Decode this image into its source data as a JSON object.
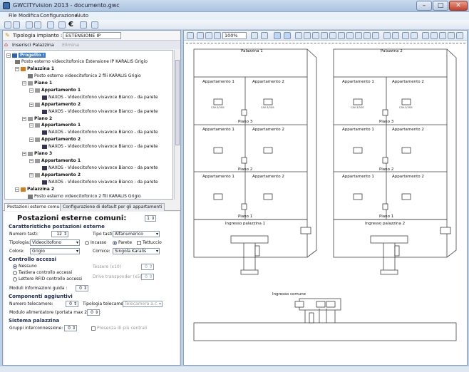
{
  "window": {
    "title": "GWCITYvision 2013 - documento.gwc",
    "min": "–",
    "max": "□",
    "close": "✕"
  },
  "menu": [
    "File",
    "Modifica",
    "Configurazione",
    "Aiuto"
  ],
  "typology": {
    "label": "Tipologia impianto :",
    "value": "ESTENSIONE IP"
  },
  "left_tabs": {
    "insert": "Inserisci Palazzina",
    "delete": "Elimina"
  },
  "tree": {
    "root": "Progetto :",
    "entrance": "Posto esterno videocitofonico Estensione IP KARALIS Grigio",
    "palazzina1": "Palazzina 1",
    "p1_post": "Posto esterno videocitofonico 2 fili KARALIS Grigio",
    "piano1": "Piano 1",
    "piano2": "Piano 2",
    "piano3": "Piano 3",
    "app1": "Appartamento 1",
    "app2": "Appartamento 2",
    "device": "NAXOS - Videocitofono vivavoce Bianco - da parete",
    "palazzina2": "Palazzina 2",
    "p2_post": "Posto esterno videocitofonico 2 fili KARALIS Grigio"
  },
  "panel_tabs": [
    "Postazioni esterne comuni",
    "Configurazione di default per gli appartamenti"
  ],
  "form": {
    "title": "Postazioni esterne comuni:",
    "count": "1",
    "s1": "Caratteristiche postazioni esterne",
    "num_tasti_label": "Numero tasti:",
    "num_tasti": "12",
    "tipo_tasti_label": "Tipo tasti:",
    "tipo_tasti": "Alfanumerico",
    "tipologia_label": "Tipologia:",
    "tipologia": "Videocitofono",
    "incasso": "Incasso",
    "parete": "Parete",
    "tettuccio": "Tettuccio",
    "colore_label": "Colore:",
    "colore": "Grigio",
    "cornice_label": "Cornice:",
    "cornice": "Singola Karalis",
    "s2": "Controllo accessi",
    "nessuno": "Nessuno",
    "tastiera": "Tastiera controllo accessi",
    "lettore": "Lettore RFID controllo accessi",
    "tessere_label": "Tessere (x10)",
    "tessere": "0",
    "drive_label": "Drive transponder (x5)",
    "drive": "0",
    "moduli_label": "Moduli informazioni guida :",
    "moduli": "0",
    "s3": "Componenti aggiuntivi",
    "telecamere_label": "Numero telecamere:",
    "telecamere": "0",
    "tipo_tele_label": "Tipologia telecamera:",
    "tipo_tele": "Telecamera a.c. IP66",
    "alim_label": "Modulo alimentatore (portata max 2 telel):",
    "alim": "0",
    "s4": "Sistema palazzina",
    "gruppi_label": "Gruppi interconnessione:",
    "gruppi": "0",
    "pres_label": "Presenza di più centrali"
  },
  "toolbar": {
    "zoom": "100%"
  },
  "drawing": {
    "b1": "Palazzina 1",
    "b2": "Palazzina 2",
    "app1": "Appartamento 1",
    "app2": "Appartamento 2",
    "floor3": "Piano 3",
    "floor2": "Piano 2",
    "floor1": "Piano 1",
    "device": "CAV-3/3GS",
    "entr1": "Ingresso palazzina 1",
    "entr2": "Ingresso palazzina 2",
    "common": "Ingresso comune"
  }
}
